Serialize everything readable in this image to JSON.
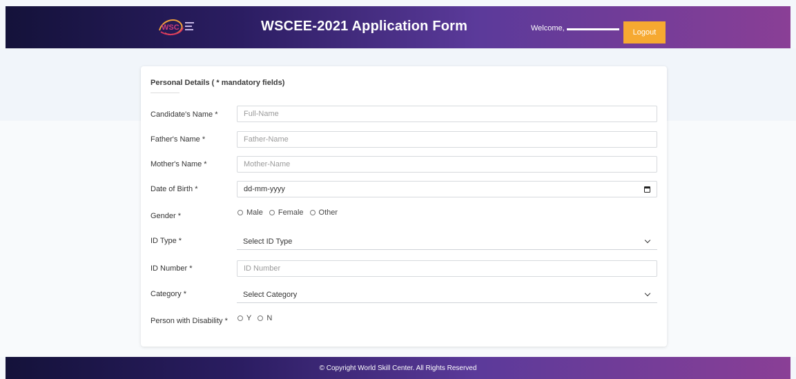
{
  "header": {
    "title": "WSCEE-2021 Application Form",
    "welcome_prefix": "Welcome,",
    "logout_label": "Logout",
    "brand_color": "#2b1d62",
    "accent_color": "#f6a931"
  },
  "form": {
    "section_title": "Personal Details ( * mandatory fields)",
    "fields": {
      "candidate_name": {
        "label": "Candidate's Name *",
        "placeholder": "Full-Name"
      },
      "father_name": {
        "label": "Father's Name *",
        "placeholder": "Father-Name"
      },
      "mother_name": {
        "label": "Mother's Name *",
        "placeholder": "Mother-Name"
      },
      "dob": {
        "label": "Date of Birth *",
        "value": "dd-mm-yyyy"
      },
      "gender": {
        "label": "Gender *",
        "options": [
          "Male",
          "Female",
          "Other"
        ]
      },
      "id_type": {
        "label": "ID Type *",
        "selected": "Select ID Type"
      },
      "id_number": {
        "label": "ID Number *",
        "placeholder": "ID Number"
      },
      "category": {
        "label": "Category *",
        "selected": "Select Category"
      },
      "disability": {
        "label": "Person with Disability *",
        "options": [
          "Y",
          "N"
        ]
      }
    }
  },
  "footer": {
    "text": "© Copyright World Skill Center. All Rights Reserved"
  },
  "icons": [
    "wsc-logo",
    "calendar-icon",
    "chevron-down-icon",
    "radio-icon"
  ]
}
